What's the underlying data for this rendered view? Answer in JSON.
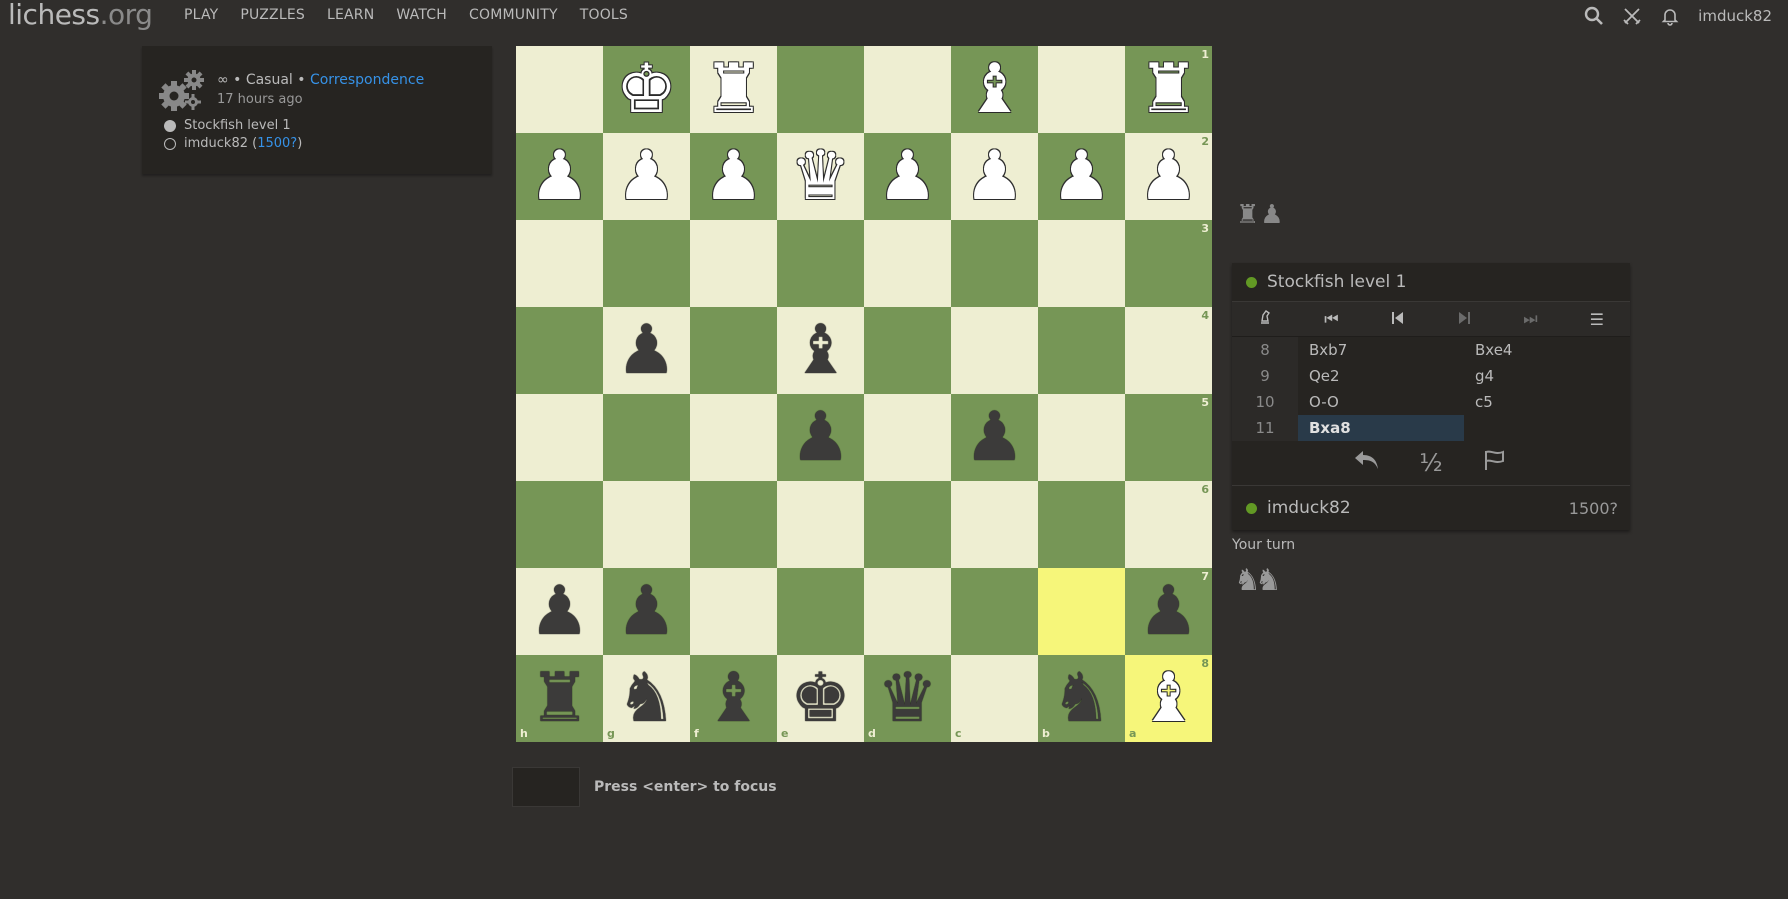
{
  "header": {
    "logo_main": "lichess",
    "logo_tld": ".org",
    "nav": [
      "PLAY",
      "PUZZLES",
      "LEARN",
      "WATCH",
      "COMMUNITY",
      "TOOLS"
    ],
    "username": "imduck82",
    "icons": [
      "search-icon",
      "swords-icon",
      "bell-icon"
    ]
  },
  "game_info": {
    "mode_prefix": "∞ • Casual • ",
    "mode_link": "Correspondence",
    "time_ago": "17 hours ago",
    "player_white": "Stockfish level 1",
    "player_black_name": "imduck82 (",
    "player_black_rating": "1500?",
    "player_black_close": ")"
  },
  "board": {
    "orientation": "black",
    "ranks": [
      "1",
      "2",
      "3",
      "4",
      "5",
      "6",
      "7",
      "8"
    ],
    "files": [
      "h",
      "g",
      "f",
      "e",
      "d",
      "c",
      "b",
      "a"
    ],
    "rows": [
      [
        "",
        "wK",
        "wR",
        "",
        "",
        "wB",
        "",
        "wR"
      ],
      [
        "wP",
        "wP",
        "wP",
        "wQ",
        "wP",
        "wP",
        "wP",
        "wP"
      ],
      [
        "",
        "",
        "",
        "",
        "",
        "",
        "",
        ""
      ],
      [
        "",
        "bP",
        "",
        "bB",
        "",
        "",
        "",
        ""
      ],
      [
        "",
        "",
        "",
        "bP",
        "",
        "bP",
        "",
        ""
      ],
      [
        "",
        "",
        "",
        "",
        "",
        "",
        "",
        ""
      ],
      [
        "bP",
        "bP",
        "",
        "",
        "",
        "",
        "",
        "bP"
      ],
      [
        "bR",
        "bN",
        "bB",
        "bK",
        "bQ",
        "",
        "bN",
        "wB"
      ]
    ],
    "highlighted": [
      "b7",
      "a8"
    ],
    "colors": {
      "light": "#eeeed2",
      "dark": "#769656",
      "highlight": "#f6f67a"
    }
  },
  "focus_hint": "Press <enter> to focus",
  "panel": {
    "captured_top": "♜♟",
    "opponent": "Stockfish level 1",
    "moves": [
      {
        "num": "8",
        "white": "Bxb7",
        "black": "Bxe4"
      },
      {
        "num": "9",
        "white": "Qe2",
        "black": "g4"
      },
      {
        "num": "10",
        "white": "O-O",
        "black": "c5"
      },
      {
        "num": "11",
        "white": "Bxa8",
        "black": ""
      }
    ],
    "active_move": "Bxa8",
    "draw_symbol": "½",
    "player": "imduck82",
    "player_rating": "1500?",
    "your_turn": "Your turn",
    "captured_bottom": "♞♞"
  }
}
